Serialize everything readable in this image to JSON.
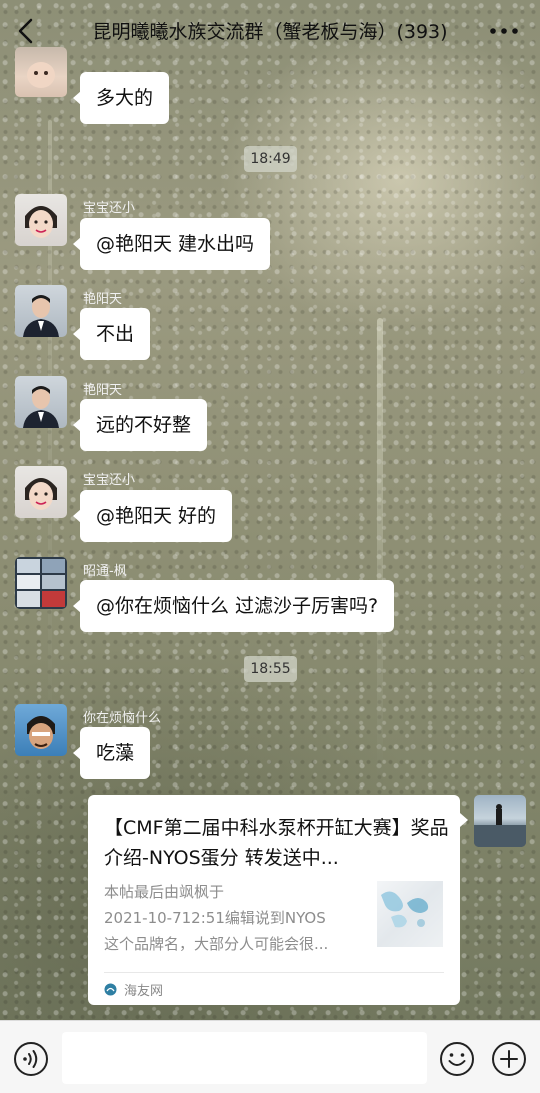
{
  "header": {
    "title": "昆明曦曦水族交流群（蟹老板与海）(393)"
  },
  "messages": [
    {
      "sender": "",
      "text": "多大的"
    },
    {
      "time": "18:49"
    },
    {
      "sender": "宝宝还小",
      "text": "@艳阳天  建水出吗"
    },
    {
      "sender": "艳阳天",
      "text": "不出"
    },
    {
      "sender": "艳阳天",
      "text": "远的不好整"
    },
    {
      "sender": "宝宝还小",
      "text": "@艳阳天  好的"
    },
    {
      "sender": "昭通-枫",
      "text": "@你在烦恼什么  过滤沙子厉害吗?"
    },
    {
      "time": "18:55"
    },
    {
      "sender": "你在烦恼什么",
      "text": "吃藻"
    }
  ],
  "link_card": {
    "title": "【CMF第二届中科水泵杯开缸大赛】奖品介绍-NYOS蛋分 转发送中...",
    "desc_lines": [
      "本帖最后由飒枫于",
      "2021-10-712:51编辑说到NYOS",
      "这个品牌名，大部分人可能会很..."
    ],
    "source": "海友网"
  },
  "input": {
    "placeholder": ""
  },
  "colors": {
    "bubble": "#ffffff",
    "bottom_bar": "#f6f6f6"
  }
}
